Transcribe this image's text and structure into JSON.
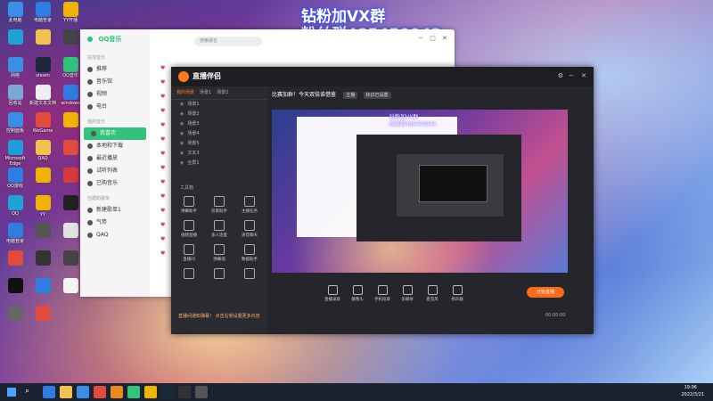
{
  "watermark": {
    "line1": "钻粉加VX群",
    "line2": "粉丝群485450943"
  },
  "desktop_icons": [
    {
      "label": "此电脑",
      "color": "#3a8ee6"
    },
    {
      "label": "电脑管家",
      "color": "#2f7de1"
    },
    {
      "label": "YY开播",
      "color": "#f0b400"
    },
    {
      "label": "",
      "color": "#1fa3d6"
    },
    {
      "label": "",
      "color": "#f2c14e"
    },
    {
      "label": "",
      "color": "#444"
    },
    {
      "label": "网络",
      "color": "#3a8ee6"
    },
    {
      "label": "steam",
      "color": "#1b2838"
    },
    {
      "label": "QQ音乐",
      "color": "#31c27c"
    },
    {
      "label": "回收站",
      "color": "#7aa7d6"
    },
    {
      "label": "新建文本文档",
      "color": "#eeeeee"
    },
    {
      "label": "windows",
      "color": "#2f7de1"
    },
    {
      "label": "控制面板",
      "color": "#3a8ee6"
    },
    {
      "label": "WeGame",
      "color": "#e24b3c"
    },
    {
      "label": "",
      "color": "#f0b400"
    },
    {
      "label": "Microsoft Edge",
      "color": "#1f9bd7"
    },
    {
      "label": "QAQ",
      "color": "#f2c14e"
    },
    {
      "label": "",
      "color": "#e24b3c"
    },
    {
      "label": "QQ游戏",
      "color": "#2f7de1"
    },
    {
      "label": "",
      "color": "#f0b400"
    },
    {
      "label": "",
      "color": "#d63a3a"
    },
    {
      "label": "QQ",
      "color": "#1fa3d6"
    },
    {
      "label": "yy",
      "color": "#f0b400"
    },
    {
      "label": "",
      "color": "#222"
    },
    {
      "label": "电脑管家",
      "color": "#2f7de1"
    },
    {
      "label": "",
      "color": "#555"
    },
    {
      "label": "",
      "color": "#e2e2e2"
    },
    {
      "label": "",
      "color": "#e24b3c"
    },
    {
      "label": "",
      "color": "#333"
    },
    {
      "label": "",
      "color": "#444"
    },
    {
      "label": "",
      "color": "#111"
    },
    {
      "label": "",
      "color": "#2f7de1"
    },
    {
      "label": "",
      "color": "#f5f5f5"
    },
    {
      "label": "",
      "color": "#666"
    },
    {
      "label": "",
      "color": "#e24b3c"
    }
  ],
  "qqmusic": {
    "app_name": "QQ音乐",
    "search_placeholder": "搜索歌名",
    "online_header": "在线音乐",
    "online_items": [
      "推荐",
      "音乐馆",
      "视频",
      "电台"
    ],
    "my_header": "我的音乐",
    "my_items": [
      "我喜欢",
      "本地和下载",
      "最近播放",
      "试听列表",
      "已购音乐"
    ],
    "playlist_header": "创建的歌单",
    "playlists": [
      "新建歌单1",
      "气势",
      "QAQ"
    ]
  },
  "douyu": {
    "title": "直播伴侣",
    "left_tabs": [
      "我的场景",
      "场景1",
      "场景2"
    ],
    "scenes": [
      "场景1",
      "场景2",
      "场景3",
      "场景4",
      "场景5",
      "文本3",
      "全屏1"
    ],
    "tools_header": "工具箱",
    "tools": [
      "弹幕助手",
      "房管助手",
      "主播任务",
      "视频直播",
      "多人连麦",
      "语音聊天",
      "直播间",
      "弹幕墙",
      "数据助手",
      "",
      "",
      ""
    ],
    "room_title": "比赛加群！今天双倍谁借鉴",
    "room_tags": [
      "主播",
      "标识已设置"
    ],
    "preview_overlay": [
      "钻粉加VX群",
      "粉丝群485450943"
    ],
    "controls": [
      "直播录屏",
      "摄像头",
      "手机投屏",
      "多媒体",
      "麦克风",
      "扬声器"
    ],
    "start_button": "开始直播",
    "status_time": "00:00:00",
    "bottom_hint": "直播间通知弹幕！ 点击右侧设置更多内容"
  },
  "taskbar": {
    "apps": [
      "#2f7de1",
      "#f2c14e",
      "#3a8ee6",
      "#e24b3c",
      "#e88a1a",
      "#31c27c",
      "#f0b400",
      "#1b2838",
      "#333",
      "#555"
    ],
    "time": "19:06",
    "date": "2022/3/21"
  }
}
